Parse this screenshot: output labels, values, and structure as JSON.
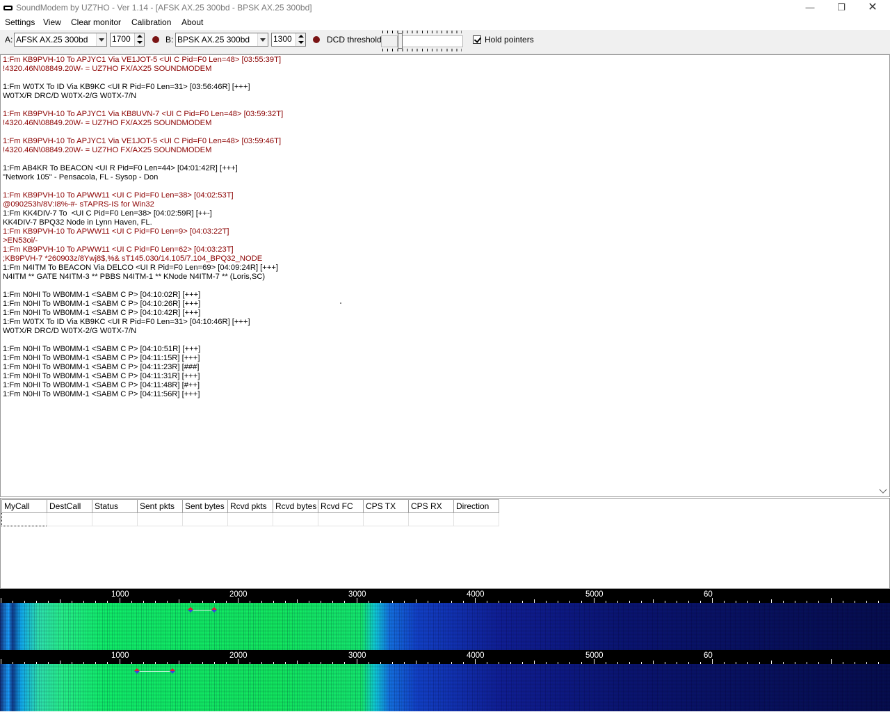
{
  "window": {
    "title": "SoundModem by UZ7HO - Ver 1.14 - [AFSK AX.25 300bd - BPSK AX.25 300bd]",
    "minimize": "—",
    "maximize": "❐",
    "close": "✕"
  },
  "menu": [
    "Settings",
    "View",
    "Clear monitor",
    "Calibration",
    "About"
  ],
  "toolbar": {
    "a_label": "A:",
    "a_mode": "AFSK AX.25 300bd",
    "a_freq": "1700",
    "b_label": "B:",
    "b_mode": "BPSK AX.25 300bd",
    "b_freq": "1300",
    "dcd_label": "DCD threshold",
    "dcd_level": 0.2,
    "hold_label": "Hold pointers",
    "hold_checked": true,
    "led_color": "#7a1414"
  },
  "monitor": {
    "lines": [
      {
        "t": "1:Fm KB9PVH-10 To APJYC1 Via VE1JOT-5 <UI C Pid=F0 Len=48> [03:55:39T]",
        "c": "red"
      },
      {
        "t": "!4320.46N\\08849.20W- = UZ7HO FX/AX25 SOUNDMODEM",
        "c": "red"
      },
      {
        "t": "",
        "c": "blk"
      },
      {
        "t": "1:Fm W0TX To ID Via KB9KC <UI R Pid=F0 Len=31> [03:56:46R] [+++]",
        "c": "blk"
      },
      {
        "t": "W0TX/R DRC/D W0TX-2/G W0TX-7/N",
        "c": "blk"
      },
      {
        "t": "",
        "c": "blk"
      },
      {
        "t": "1:Fm KB9PVH-10 To APJYC1 Via KB8UVN-7 <UI C Pid=F0 Len=48> [03:59:32T]",
        "c": "red"
      },
      {
        "t": "!4320.46N\\08849.20W- = UZ7HO FX/AX25 SOUNDMODEM",
        "c": "red"
      },
      {
        "t": "",
        "c": "blk"
      },
      {
        "t": "1:Fm KB9PVH-10 To APJYC1 Via VE1JOT-5 <UI C Pid=F0 Len=48> [03:59:46T]",
        "c": "red"
      },
      {
        "t": "!4320.46N\\08849.20W- = UZ7HO FX/AX25 SOUNDMODEM",
        "c": "red"
      },
      {
        "t": "",
        "c": "blk"
      },
      {
        "t": "1:Fm AB4KR To BEACON <UI R Pid=F0 Len=44> [04:01:42R] [+++]",
        "c": "blk"
      },
      {
        "t": "\"Network 105\" - Pensacola, FL - Sysop - Don",
        "c": "blk"
      },
      {
        "t": "",
        "c": "blk"
      },
      {
        "t": "1:Fm KB9PVH-10 To APWW11 <UI C Pid=F0 Len=38> [04:02:53T]",
        "c": "red"
      },
      {
        "t": "@090253h/8V:I8%-#- sTAPRS-IS for Win32",
        "c": "red"
      },
      {
        "t": "1:Fm KK4DIV-7 To  <UI C Pid=F0 Len=38> [04:02:59R] [++-]",
        "c": "blk"
      },
      {
        "t": "KK4DIV-7 BPQ32 Node in Lynn Haven, FL.",
        "c": "blk"
      },
      {
        "t": "1:Fm KB9PVH-10 To APWW11 <UI C Pid=F0 Len=9> [04:03:22T]",
        "c": "red"
      },
      {
        "t": ">EN53oi/-",
        "c": "red"
      },
      {
        "t": "1:Fm KB9PVH-10 To APWW11 <UI C Pid=F0 Len=62> [04:03:23T]",
        "c": "red"
      },
      {
        "t": ";KB9PVH-7 *260903z/8Ywj8$,%& sT145.030/14.105/7.104_BPQ32_NODE",
        "c": "red"
      },
      {
        "t": "1:Fm N4ITM To BEACON Via DELCO <UI R Pid=F0 Len=69> [04:09:24R] [+++]",
        "c": "blk"
      },
      {
        "t": "N4ITM ** GATE N4ITM-3 ** PBBS N4ITM-1 ** KNode N4ITM-7 ** (Loris,SC)",
        "c": "blk"
      },
      {
        "t": "",
        "c": "blk"
      },
      {
        "t": "1:Fm N0HI To WB0MM-1 <SABM C P> [04:10:02R] [+++]",
        "c": "blk"
      },
      {
        "t": "1:Fm N0HI To WB0MM-1 <SABM C P> [04:10:26R] [+++]",
        "c": "blk"
      },
      {
        "t": "1:Fm N0HI To WB0MM-1 <SABM C P> [04:10:42R] [+++]",
        "c": "blk"
      },
      {
        "t": "1:Fm W0TX To ID Via KB9KC <UI R Pid=F0 Len=31> [04:10:46R] [+++]",
        "c": "blk"
      },
      {
        "t": "W0TX/R DRC/D W0TX-2/G W0TX-7/N",
        "c": "blk"
      },
      {
        "t": "",
        "c": "blk"
      },
      {
        "t": "1:Fm N0HI To WB0MM-1 <SABM C P> [04:10:51R] [+++]",
        "c": "blk"
      },
      {
        "t": "1:Fm N0HI To WB0MM-1 <SABM C P> [04:11:15R] [+++]",
        "c": "blk"
      },
      {
        "t": "1:Fm N0HI To WB0MM-1 <SABM C P> [04:11:23R] [###]",
        "c": "blk"
      },
      {
        "t": "1:Fm N0HI To WB0MM-1 <SABM C P> [04:11:31R] [+++]",
        "c": "blk"
      },
      {
        "t": "1:Fm N0HI To WB0MM-1 <SABM C P> [04:11:48R] [#++]",
        "c": "blk"
      },
      {
        "t": "1:Fm N0HI To WB0MM-1 <SABM C P> [04:11:56R] [+++]",
        "c": "blk"
      }
    ],
    "red_color": "#8b0000"
  },
  "table": {
    "headers": [
      "MyCall",
      "DestCall",
      "Status",
      "Sent pkts",
      "Sent bytes",
      "Rcvd pkts",
      "Rcvd bytes",
      "Rcvd FC",
      "CPS TX",
      "CPS RX",
      "Direction"
    ]
  },
  "waterfall": {
    "scale_labels": [
      "1000",
      "2000",
      "3000",
      "4000",
      "5000",
      "60"
    ],
    "scale_values": [
      1000,
      2000,
      3000,
      4000,
      5000,
      6000
    ],
    "channel_a": {
      "low_hz": 1600,
      "high_hz": 1800
    },
    "channel_b": {
      "low_hz": 1150,
      "high_hz": 1450
    }
  }
}
